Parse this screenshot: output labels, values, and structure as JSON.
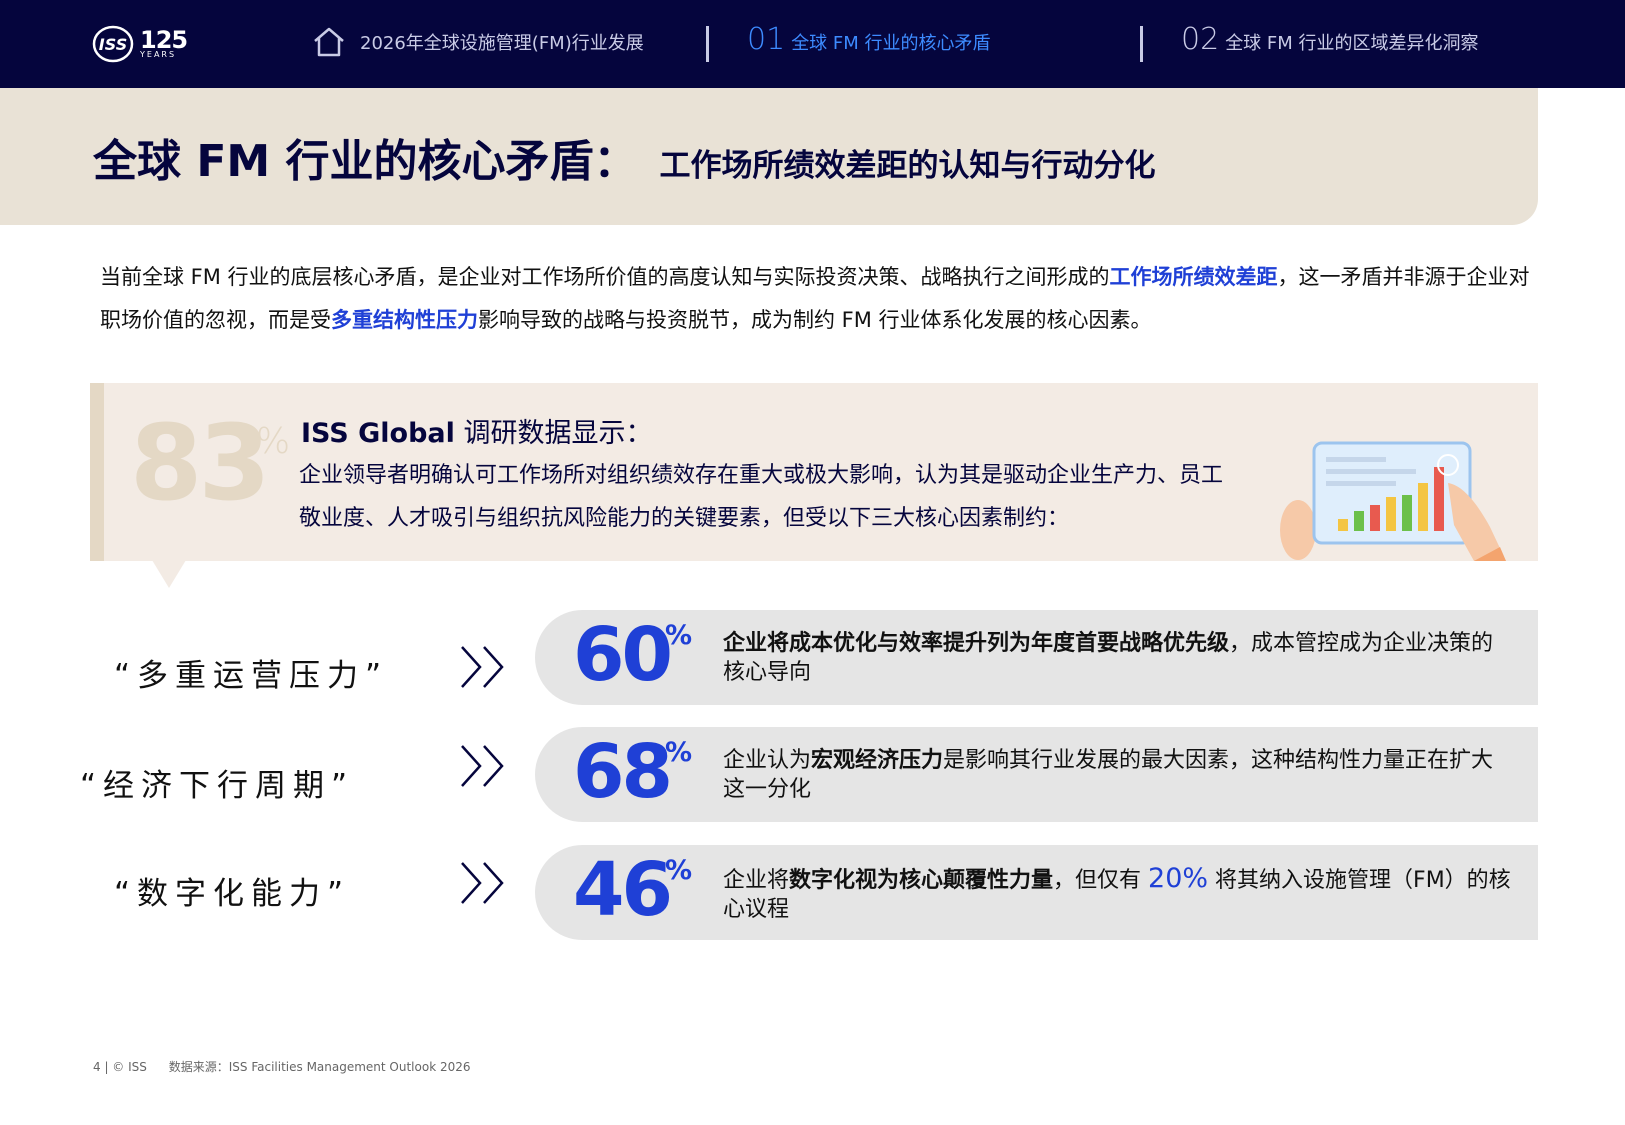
{
  "nav": {
    "logo_text": "ISS",
    "logo_number": "125",
    "logo_years": "YEARS",
    "home_label": "2026年全球设施管理(FM)行业发展",
    "items": [
      {
        "num": "01",
        "label": "全球 FM 行业的核心矛盾",
        "active": true
      },
      {
        "num": "02",
        "label": "全球 FM 行业的区域差异化洞察",
        "active": false
      }
    ]
  },
  "title": {
    "main": "全球 FM 行业的核心矛盾：",
    "sub": "工作场所绩效差距的认知与行动分化"
  },
  "intro": {
    "part1": "当前全球 FM 行业的底层核心矛盾，是企业对工作场所价值的高度认知与实际投资决策、战略执行之间形成的",
    "highlight1": "工作场所绩效差距",
    "part2": "，这一矛盾并非源于企业对职场价值的忽视，而是受",
    "highlight2": "多重结构性压力",
    "part3": "影响导致的战略与投资脱节，成为制约 FM 行业体系化发展的核心因素。"
  },
  "stat": {
    "value": "83",
    "unit": "%",
    "source_bold": "ISS Global",
    "source_rest": " 调研数据显示：",
    "body": "企业领导者明确认可工作场所对组织绩效存在重大或极大影响，认为其是驱动企业生产力、员工敬业度、人才吸引与组织抗风险能力的关键要素，但受以下三大核心因素制约："
  },
  "factors": [
    {
      "label": "“多重运营压力”",
      "value": "60",
      "unit": "%",
      "text_bold": "企业将成本优化与效率提升列为年度首要战略优先级",
      "text_rest": "，成本管控成为企业决策的核心导向"
    },
    {
      "label": "“经济下行周期”",
      "value": "68",
      "unit": "%",
      "text_pre": "企业认为",
      "text_bold": "宏观经济压力",
      "text_rest": "是影响其行业发展的最大因素，这种结构性力量正在扩大这一分化"
    },
    {
      "label": "“数字化能力”",
      "value": "46",
      "unit": "%",
      "text_pre": "企业将",
      "text_bold": "数字化视为核心颠覆性力量",
      "text_mid": "，但仅有 ",
      "text_blue": "20%",
      "text_rest": " 将其纳入设施管理（FM）的核心议程"
    }
  ],
  "footer": {
    "page": "4 |  © ISS",
    "source": "数据来源：ISS Facilities Management Outlook 2026"
  },
  "colors": {
    "navy": "#05053d",
    "accent_blue": "#1f40d6",
    "nav_active": "#3d8bff",
    "beige": "#e9e2d6",
    "stat_bg": "#f3ebe4",
    "pill_bg": "#e5e5e5"
  }
}
